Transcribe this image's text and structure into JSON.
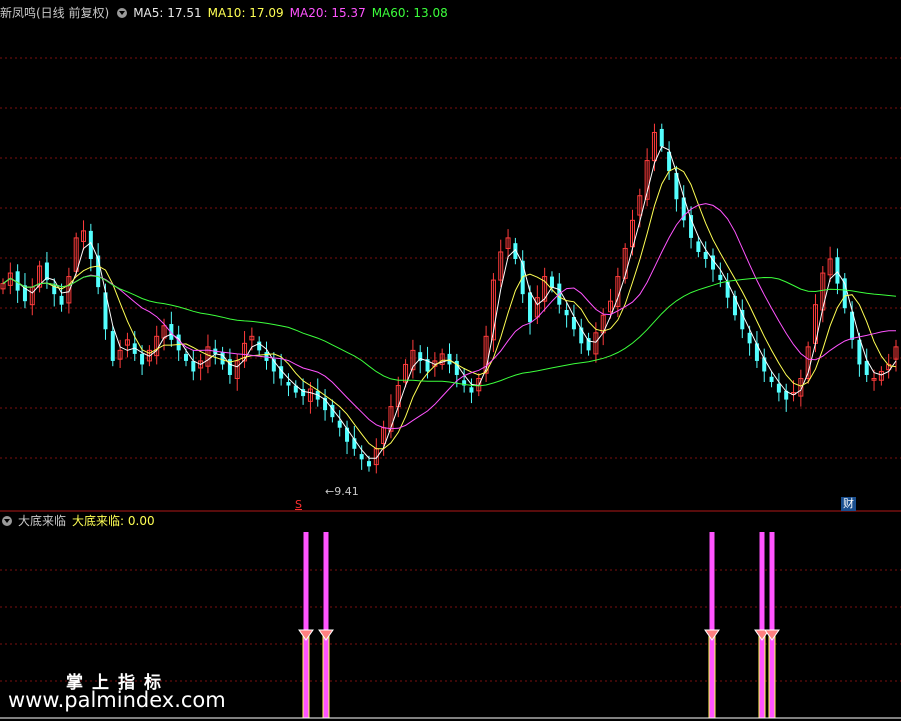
{
  "main_header": {
    "title": "新凤鸣(日线 前复权)",
    "ma5": "MA5: 17.51",
    "ma10": "MA10: 17.09",
    "ma20": "MA20: 15.37",
    "ma60": "MA60: 13.08"
  },
  "indicator_header": {
    "title": "大底来临",
    "value": "大底来临: 0.00"
  },
  "colors": {
    "background": "#000000",
    "grid": "#7a1010",
    "up": "#ff3c3c",
    "down": "#54ffff",
    "ma5": "#ffffff",
    "ma10": "#ffff54",
    "ma20": "#ff54ff",
    "ma60": "#3cff3c",
    "signal": "#ff54ff",
    "marker": "#ff8080"
  },
  "markers": {
    "low_price": "9.41",
    "s_mark": "S",
    "cai_mark": "财"
  },
  "watermark": {
    "line1": "掌上指标",
    "line2": "www.palmindex.com"
  },
  "chart_data": {
    "type": "candlestick",
    "price_range": [
      9.0,
      22.6
    ],
    "indicator_range": [
      0,
      1
    ],
    "closes": [
      15.1,
      15.4,
      14.9,
      14.6,
      15.0,
      15.6,
      15.2,
      14.8,
      14.5,
      15.3,
      16.4,
      16.6,
      15.8,
      15.0,
      13.8,
      12.9,
      13.2,
      13.5,
      13.1,
      12.8,
      13.2,
      13.6,
      13.9,
      13.5,
      13.2,
      12.9,
      12.6,
      12.9,
      13.3,
      13.1,
      12.8,
      12.5,
      12.9,
      13.4,
      13.6,
      13.2,
      12.9,
      12.6,
      12.4,
      12.2,
      12.0,
      11.9,
      12.1,
      11.8,
      11.5,
      11.3,
      11.0,
      10.6,
      10.4,
      10.1,
      9.9,
      10.4,
      11.0,
      11.6,
      12.2,
      12.8,
      13.2,
      12.9,
      12.6,
      12.9,
      13.1,
      12.8,
      12.5,
      12.2,
      12.0,
      12.4,
      13.6,
      15.2,
      16.0,
      16.4,
      15.8,
      14.8,
      14.0,
      14.7,
      15.3,
      15.0,
      14.5,
      14.2,
      13.8,
      13.4,
      13.2,
      13.7,
      14.2,
      14.6,
      15.3,
      16.1,
      16.9,
      17.6,
      18.6,
      19.4,
      19.0,
      18.3,
      17.5,
      16.9,
      16.4,
      16.0,
      15.8,
      15.5,
      15.2,
      14.7,
      14.2,
      13.8,
      13.4,
      12.9,
      12.6,
      12.3,
      12.0,
      11.8,
      12.0,
      12.4,
      13.3,
      14.5,
      15.4,
      15.8,
      15.1,
      14.4,
      13.5,
      12.8,
      12.5,
      12.4,
      12.6,
      12.8,
      13.3
    ],
    "signal_bars": [
      305,
      307,
      325,
      327,
      711,
      713,
      761,
      763,
      771,
      773
    ],
    "signal_markers": [
      306,
      326,
      712,
      762,
      772
    ],
    "low_marker_value": 9.41
  }
}
